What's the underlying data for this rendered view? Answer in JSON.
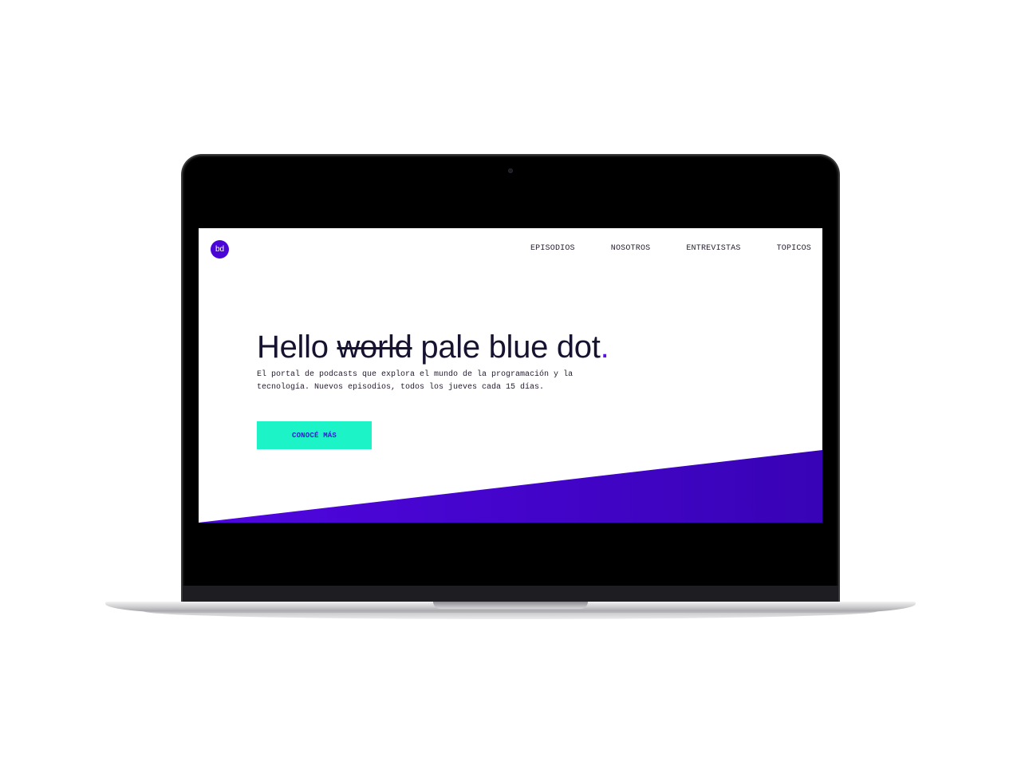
{
  "site": {
    "logo_text": "bd",
    "nav": [
      {
        "label": "EPISODIOS"
      },
      {
        "label": "NOSOTROS"
      },
      {
        "label": "ENTREVISTAS"
      },
      {
        "label": "TOPICOS"
      }
    ]
  },
  "hero": {
    "headline_start": "Hello ",
    "headline_struck": "world",
    "headline_end": " pale blue dot",
    "headline_dot": ".",
    "subtitle": "El portal de podcasts que explora el mundo de la programación y la tecnología. Nuevos episodios, todos los jueves cada 15 días.",
    "cta_label": "CONOCÉ MÁS"
  },
  "colors": {
    "brand_purple": "#4a06d6",
    "accent_mint": "#1cf4c8",
    "text_dark": "#161331"
  }
}
